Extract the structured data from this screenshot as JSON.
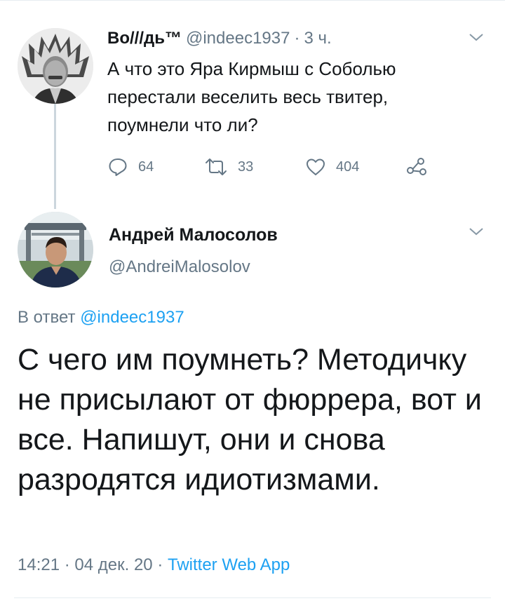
{
  "parent_tweet": {
    "display_name": "Во///дь™",
    "handle": "@indeec1937",
    "separator": "·",
    "time": "3 ч.",
    "text": "А что это Яра Кирмыш с Соболью перестали веселить весь твитер, поумнели что ли?",
    "avatar_icon": "avatar-chief-headdress",
    "stats": {
      "replies": "64",
      "retweets": "33",
      "likes": "404"
    }
  },
  "reply_tweet": {
    "display_name": "Андрей Малосолов",
    "handle": "@AndreiMalosolov",
    "avatar_icon": "avatar-man-photo",
    "replying_prefix": "В ответ",
    "replying_to": "@indeec1937",
    "text": "С чего им поумнеть? Методичку не присылают от фюррера, вот и все. Напишут, они и снова разродятся идиотизмами.",
    "time": "14:21",
    "separator": "·",
    "date": "04 дек. 20",
    "source": "Twitter Web App"
  },
  "colors": {
    "text": "#14171a",
    "secondary": "#657786",
    "link": "#1da1f2",
    "divider": "#e6ecf0",
    "thread_line": "#ccd6dd"
  }
}
